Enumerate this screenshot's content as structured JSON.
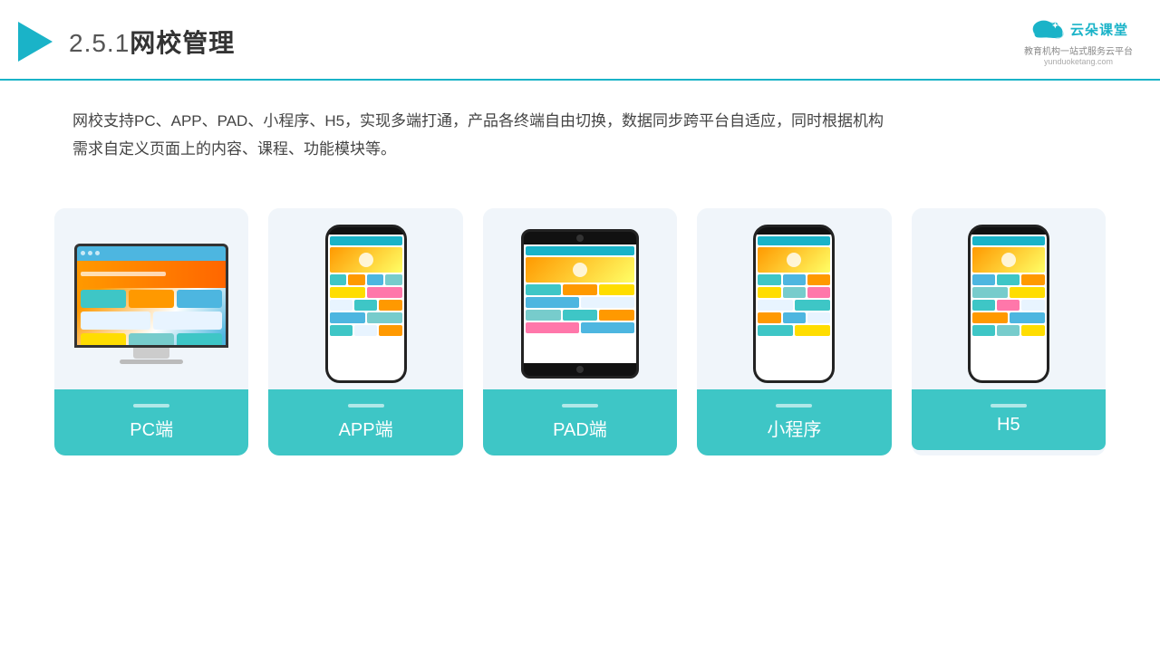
{
  "header": {
    "title": "2.5.1网校管理",
    "title_num": "2.5.1",
    "title_name": "网校管理"
  },
  "logo": {
    "name": "云朵课堂",
    "url": "yunduoketang.com",
    "tagline": "教育机构一站\n式服务云平台"
  },
  "description": {
    "text": "网校支持PC、APP、PAD、小程序、H5，实现多端打通，产品各终端自由切换，数据同步跨平台自适应，同时根据机构需求自定义页面上的内容、课程、功能模块等。"
  },
  "cards": [
    {
      "label": "PC端",
      "type": "pc"
    },
    {
      "label": "APP端",
      "type": "phone"
    },
    {
      "label": "PAD端",
      "type": "tablet"
    },
    {
      "label": "小程序",
      "type": "phone"
    },
    {
      "label": "H5",
      "type": "phone"
    }
  ]
}
